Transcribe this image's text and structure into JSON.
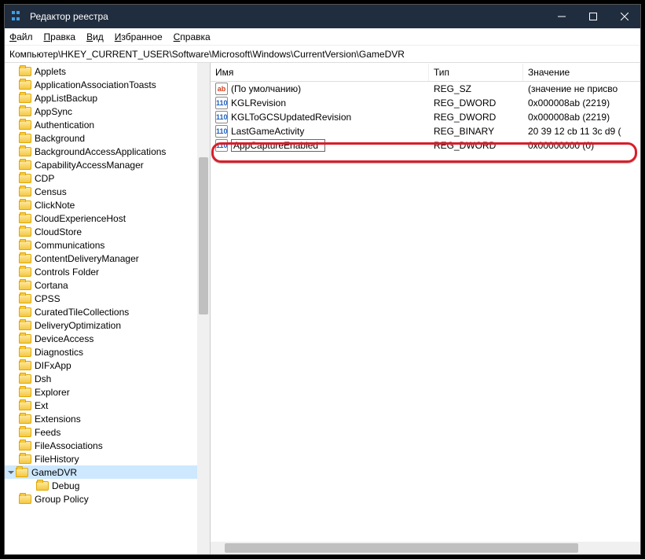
{
  "title": "Редактор реестра",
  "menu": {
    "file": "Файл",
    "edit": "Правка",
    "view": "Вид",
    "favorites": "Избранное",
    "help": "Справка"
  },
  "address": "Компьютер\\HKEY_CURRENT_USER\\Software\\Microsoft\\Windows\\CurrentVersion\\GameDVR",
  "tree": [
    {
      "label": "Applets"
    },
    {
      "label": "ApplicationAssociationToasts"
    },
    {
      "label": "AppListBackup"
    },
    {
      "label": "AppSync"
    },
    {
      "label": "Authentication"
    },
    {
      "label": "Background"
    },
    {
      "label": "BackgroundAccessApplications"
    },
    {
      "label": "CapabilityAccessManager"
    },
    {
      "label": "CDP"
    },
    {
      "label": "Census"
    },
    {
      "label": "ClickNote"
    },
    {
      "label": "CloudExperienceHost"
    },
    {
      "label": "CloudStore"
    },
    {
      "label": "Communications"
    },
    {
      "label": "ContentDeliveryManager"
    },
    {
      "label": "Controls Folder"
    },
    {
      "label": "Cortana"
    },
    {
      "label": "CPSS"
    },
    {
      "label": "CuratedTileCollections"
    },
    {
      "label": "DeliveryOptimization"
    },
    {
      "label": "DeviceAccess"
    },
    {
      "label": "Diagnostics"
    },
    {
      "label": "DIFxApp"
    },
    {
      "label": "Dsh"
    },
    {
      "label": "Explorer"
    },
    {
      "label": "Ext"
    },
    {
      "label": "Extensions"
    },
    {
      "label": "Feeds"
    },
    {
      "label": "FileAssociations"
    },
    {
      "label": "FileHistory"
    },
    {
      "label": "GameDVR",
      "selected": true,
      "expanded": true,
      "children": [
        {
          "label": "Debug"
        }
      ]
    },
    {
      "label": "Group Policy"
    }
  ],
  "columns": {
    "name": "Имя",
    "type": "Тип",
    "value": "Значение"
  },
  "values": [
    {
      "icon": "sz",
      "name": "(По умолчанию)",
      "type": "REG_SZ",
      "value": "(значение не присво"
    },
    {
      "icon": "bin",
      "name": "KGLRevision",
      "type": "REG_DWORD",
      "value": "0x000008ab (2219)"
    },
    {
      "icon": "bin",
      "name": "KGLToGCSUpdatedRevision",
      "type": "REG_DWORD",
      "value": "0x000008ab (2219)"
    },
    {
      "icon": "bin",
      "name": "LastGameActivity",
      "type": "REG_BINARY",
      "value": "20 39 12 cb 11 3c d9 ("
    },
    {
      "icon": "bin",
      "name": "AppCaptureEnabled",
      "type": "REG_DWORD",
      "value": "0x00000000 (0)",
      "editing": true
    }
  ]
}
